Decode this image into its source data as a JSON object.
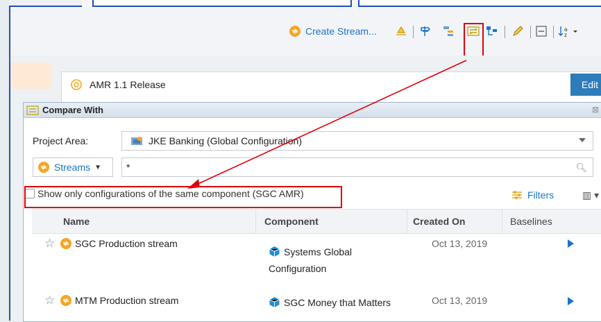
{
  "toolbar": {
    "create_stream_label": "Create Stream...",
    "icons": [
      "stream-icon",
      "baseline-icon",
      "signpost-icon",
      "hierarchy-icon",
      "compare-icon",
      "tree-icon",
      "edit-icon",
      "collapse-icon",
      "sort-icon"
    ]
  },
  "card": {
    "title": "AMR 1.1 Release",
    "edit_label": "Edit"
  },
  "dialog": {
    "title": "Compare With",
    "project_area_label": "Project Area:",
    "project_area_value": "JKE Banking (Global Configuration)",
    "type_label": "Streams",
    "filter_value": "*",
    "show_only_label": "Show only configurations of the same component (SGC AMR)",
    "filters_label": "Filters",
    "columns": [
      "Name",
      "Component",
      "Created On",
      "Baselines"
    ],
    "rows": [
      {
        "name": "SGC Production stream",
        "component": "Systems Global",
        "component2": "Configuration",
        "created": "Oct 13, 2019"
      },
      {
        "name": "MTM Production stream",
        "component": "SGC Money that Matters",
        "created": "Oct 13, 2019"
      }
    ]
  },
  "colors": {
    "accent": "#1a73c9",
    "highlight": "#e0000a",
    "edit": "#2e7cb9",
    "stream": "#f5a623"
  }
}
